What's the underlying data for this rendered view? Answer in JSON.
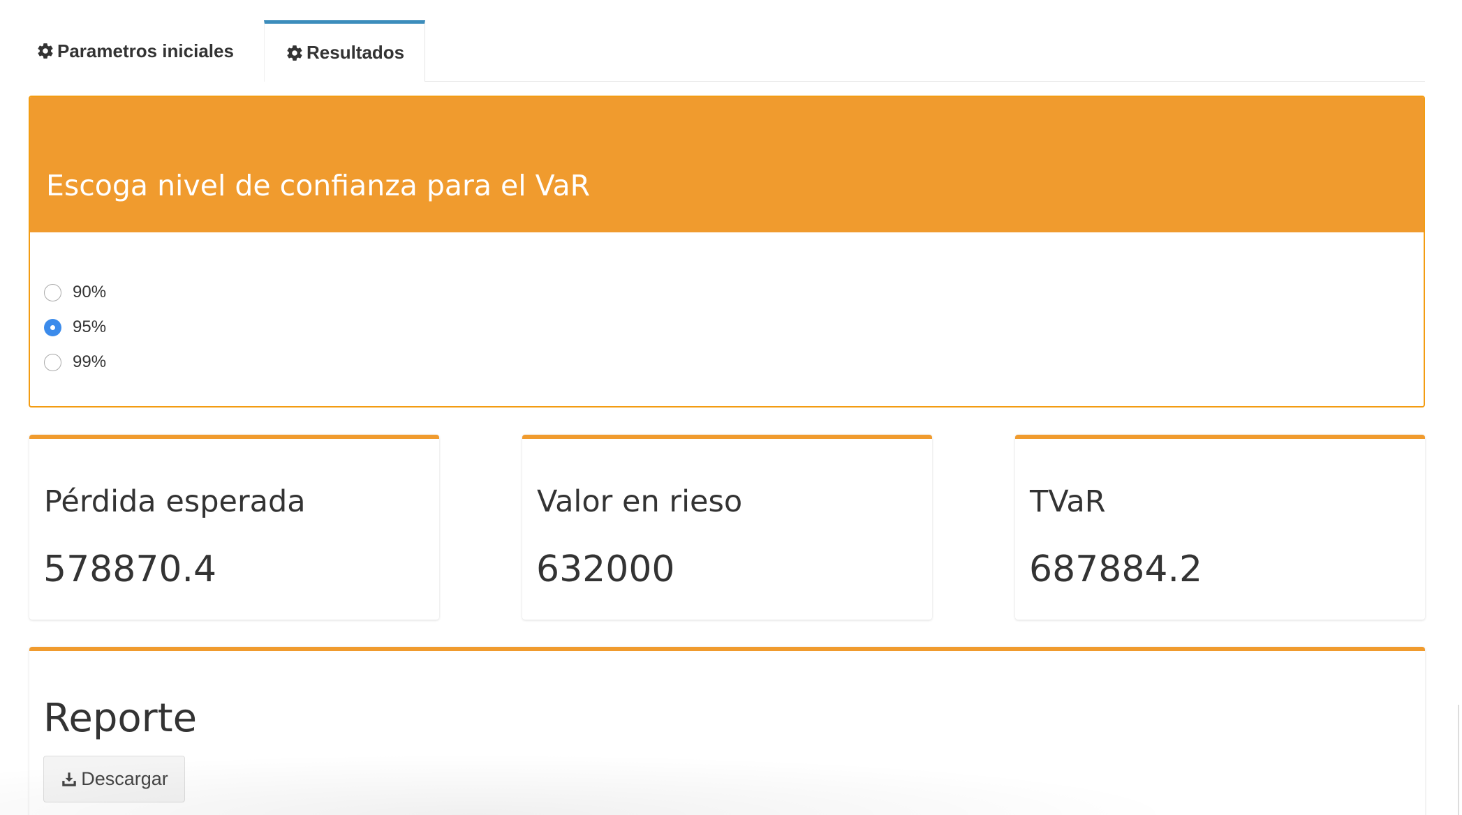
{
  "tabs": [
    {
      "label": "Parametros iniciales",
      "icon": "gear-icon",
      "active": false
    },
    {
      "label": "Resultados",
      "icon": "gear-icon",
      "active": true
    }
  ],
  "confidence_box": {
    "title": "Escoga nivel de confianza para el VaR",
    "header_color": "#f09b2e",
    "options": [
      {
        "label": "90%",
        "selected": false
      },
      {
        "label": "95%",
        "selected": true
      },
      {
        "label": "99%",
        "selected": false
      }
    ]
  },
  "metrics": [
    {
      "title": "Pérdida esperada",
      "value": "578870.4"
    },
    {
      "title": "Valor en rieso",
      "value": "632000"
    },
    {
      "title": "TVaR",
      "value": "687884.2"
    }
  ],
  "report": {
    "title": "Reporte",
    "download_label": "Descargar",
    "download_icon": "download-icon"
  },
  "colors": {
    "accent": "#f09b2e",
    "active_tab": "#3c8dbc",
    "radio_selected": "#3b8beb"
  }
}
